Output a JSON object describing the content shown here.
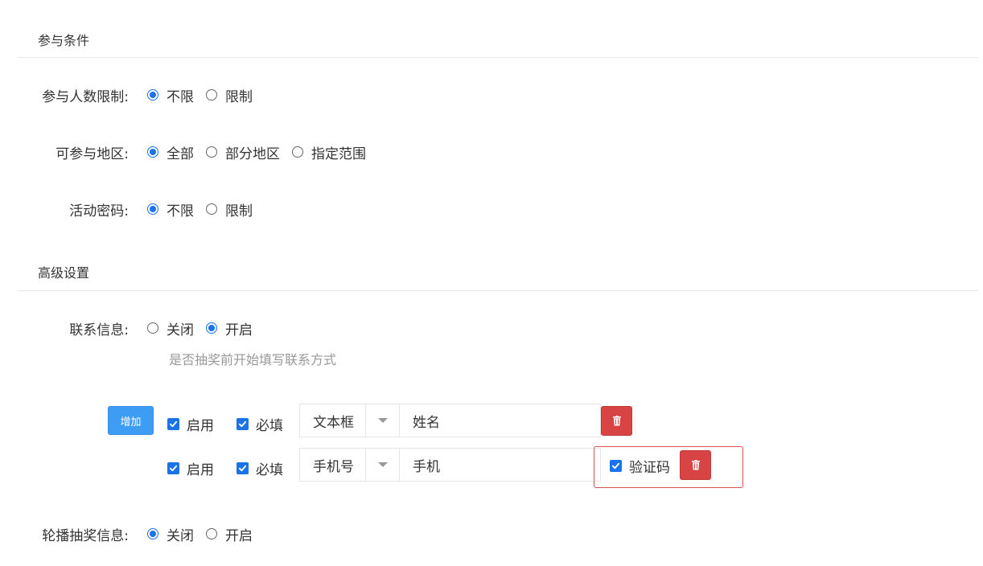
{
  "sections": {
    "participation": {
      "title": "参与条件"
    },
    "advanced": {
      "title": "高级设置"
    }
  },
  "participant_limit": {
    "label": "参与人数限制:",
    "options": [
      "不限",
      "限制"
    ],
    "selected": "不限"
  },
  "region": {
    "label": "可参与地区:",
    "options": [
      "全部",
      "部分地区",
      "指定范围"
    ],
    "selected": "全部"
  },
  "password": {
    "label": "活动密码:",
    "options": [
      "不限",
      "限制"
    ],
    "selected": "不限"
  },
  "contact_info": {
    "label": "联系信息:",
    "options": [
      "关闭",
      "开启"
    ],
    "selected": "开启",
    "hint": "是否抽奖前开始填写联系方式"
  },
  "fields": {
    "add_label": "增加",
    "rows": [
      {
        "enable_label": "启用",
        "required_label": "必填",
        "type": "文本框",
        "name": "姓名"
      },
      {
        "enable_label": "启用",
        "required_label": "必填",
        "type": "手机号",
        "name": "手机",
        "verify_label": "验证码"
      }
    ]
  },
  "carousel": {
    "label": "轮播抽奖信息:",
    "options": [
      "关闭",
      "开启"
    ],
    "selected": "关闭"
  },
  "colors": {
    "accent": "#1a73e8",
    "add_button": "#3d9cf3",
    "delete_button": "#d84444",
    "highlight_border": "#e05252",
    "hint_text": "#999999"
  },
  "icons": {
    "delete": "trash-icon",
    "dropdown": "caret-down-icon",
    "checkbox": "checkmark-icon"
  }
}
